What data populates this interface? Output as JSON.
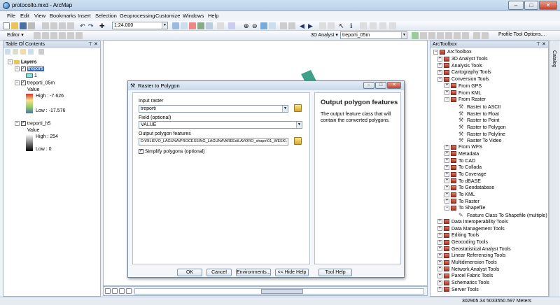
{
  "window": {
    "title": "protocollo.mxd - ArcMap",
    "min": "–",
    "max": "□",
    "close": "✕"
  },
  "menu": [
    "File",
    "Edit",
    "View",
    "Bookmarks",
    "Insert",
    "Selection",
    "Geoprocessing",
    "Customize",
    "Windows",
    "Help"
  ],
  "toolbar": {
    "scale": "1:24.000",
    "editor": "Editor ▾",
    "analyst": "3D Analyst ▾",
    "layer": "treporti_05m",
    "profile": "Profile Tool Options..."
  },
  "toc": {
    "title": "Table Of Contents",
    "layers_label": "Layers",
    "items": [
      {
        "name": "treporti",
        "sub": "1"
      },
      {
        "name": "treporti_05m",
        "value_label": "Value",
        "high": "High : -7.626",
        "low": "Low : -17.576"
      },
      {
        "name": "treporti_h5",
        "value_label": "Value",
        "high": "High : 254",
        "low": "Low : 0"
      }
    ]
  },
  "toolbox": {
    "title": "ArcToolbox",
    "catalog": "Catalog",
    "root": "ArcToolbox",
    "items": [
      {
        "label": "3D Analyst Tools",
        "level": 0,
        "kind": "box",
        "exp": "+"
      },
      {
        "label": "Analysis Tools",
        "level": 0,
        "kind": "box",
        "exp": "+"
      },
      {
        "label": "Cartography Tools",
        "level": 0,
        "kind": "box",
        "exp": "+"
      },
      {
        "label": "Conversion Tools",
        "level": 0,
        "kind": "box",
        "exp": "−"
      },
      {
        "label": "From GPS",
        "level": 1,
        "kind": "box",
        "exp": "+"
      },
      {
        "label": "From KML",
        "level": 1,
        "kind": "box",
        "exp": "+"
      },
      {
        "label": "From Raster",
        "level": 1,
        "kind": "box",
        "exp": "−"
      },
      {
        "label": "Raster to ASCII",
        "level": 2,
        "kind": "tool"
      },
      {
        "label": "Raster to Float",
        "level": 2,
        "kind": "tool"
      },
      {
        "label": "Raster to Point",
        "level": 2,
        "kind": "tool"
      },
      {
        "label": "Raster to Polygon",
        "level": 2,
        "kind": "tool"
      },
      {
        "label": "Raster to Polyline",
        "level": 2,
        "kind": "tool"
      },
      {
        "label": "Raster To Video",
        "level": 2,
        "kind": "tool"
      },
      {
        "label": "From WFS",
        "level": 1,
        "kind": "box",
        "exp": "+"
      },
      {
        "label": "Metadata",
        "level": 1,
        "kind": "box",
        "exp": "+"
      },
      {
        "label": "To CAD",
        "level": 1,
        "kind": "box",
        "exp": "+"
      },
      {
        "label": "To Collada",
        "level": 1,
        "kind": "box",
        "exp": "+"
      },
      {
        "label": "To Coverage",
        "level": 1,
        "kind": "box",
        "exp": "+"
      },
      {
        "label": "To dBASE",
        "level": 1,
        "kind": "box",
        "exp": "+"
      },
      {
        "label": "To Geodatabase",
        "level": 1,
        "kind": "box",
        "exp": "+"
      },
      {
        "label": "To KML",
        "level": 1,
        "kind": "box",
        "exp": "+"
      },
      {
        "label": "To Raster",
        "level": 1,
        "kind": "box",
        "exp": "+"
      },
      {
        "label": "To Shapefile",
        "level": 1,
        "kind": "box",
        "exp": "−"
      },
      {
        "label": "Feature Class To Shapefile (multiple)",
        "level": 2,
        "kind": "script"
      },
      {
        "label": "Data Interoperability Tools",
        "level": 0,
        "kind": "box",
        "exp": "+"
      },
      {
        "label": "Data Management Tools",
        "level": 0,
        "kind": "box",
        "exp": "+"
      },
      {
        "label": "Editing Tools",
        "level": 0,
        "kind": "box",
        "exp": "+"
      },
      {
        "label": "Geocoding Tools",
        "level": 0,
        "kind": "box",
        "exp": "+"
      },
      {
        "label": "Geostatistical Analyst Tools",
        "level": 0,
        "kind": "box",
        "exp": "+"
      },
      {
        "label": "Linear Referencing Tools",
        "level": 0,
        "kind": "box",
        "exp": "+"
      },
      {
        "label": "Multidimension Tools",
        "level": 0,
        "kind": "box",
        "exp": "+"
      },
      {
        "label": "Network Analyst Tools",
        "level": 0,
        "kind": "box",
        "exp": "+"
      },
      {
        "label": "Parcel Fabric Tools",
        "level": 0,
        "kind": "box",
        "exp": "+"
      },
      {
        "label": "Schematics Tools",
        "level": 0,
        "kind": "box",
        "exp": "+"
      },
      {
        "label": "Server Tools",
        "level": 0,
        "kind": "box",
        "exp": "+"
      }
    ]
  },
  "dialog": {
    "title": "Raster to Polygon",
    "input_raster_label": "Input raster",
    "input_raster": "treporti",
    "field_label": "Field (optional)",
    "field": "VALUE",
    "output_label": "Output polygon features",
    "output": "D:\\RILIEVO_LAGUNA\\PROCESSING_LAGUNA\\AREEdiLAVORO_shape\\01_WEEK\\...",
    "simplify_label": "Simplify polygons (optional)",
    "help_title": "Output polygon features",
    "help_text": "The output feature class that will contain the converted polygons.",
    "buttons": {
      "ok": "OK",
      "cancel": "Cancel",
      "env": "Environments...",
      "hide": "<< Hide Help",
      "toolhelp": "Tool Help"
    }
  },
  "status": {
    "coords": "302905.34  5033550.597 Meters"
  }
}
